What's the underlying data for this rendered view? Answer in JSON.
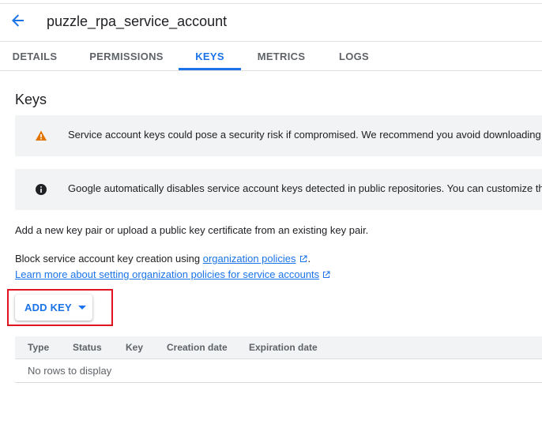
{
  "header": {
    "title": "puzzle_rpa_service_account",
    "back_icon": "arrow-back-icon"
  },
  "tabs": [
    {
      "label": "DETAILS",
      "active": false
    },
    {
      "label": "PERMISSIONS",
      "active": false
    },
    {
      "label": "KEYS",
      "active": true
    },
    {
      "label": "METRICS",
      "active": false
    },
    {
      "label": "LOGS",
      "active": false
    }
  ],
  "section": {
    "title": "Keys"
  },
  "banners": {
    "warning": {
      "icon": "warning-icon",
      "color": "#e37400",
      "text": "Service account keys could pose a security risk if compromised. We recommend you avoid downloading service account keys and instead use the Workload Identity Federation."
    },
    "info": {
      "icon": "info-icon",
      "color": "#202124",
      "text": "Google automatically disables service account keys detected in public repositories. You can customize this behavior by using the organization policy."
    }
  },
  "body": {
    "add_key_hint": "Add a new key pair or upload a public key certificate from an existing key pair.",
    "block_text": "Block service account key creation using ",
    "org_policies_link": "organization policies",
    "block_text_end": ".",
    "learn_more_link": "Learn more about setting organization policies for service accounts"
  },
  "add_key_button": {
    "label": "ADD KEY"
  },
  "table": {
    "columns": [
      "Type",
      "Status",
      "Key",
      "Creation date",
      "Expiration date"
    ],
    "empty_message": "No rows to display"
  },
  "colors": {
    "accent": "#1a73e8",
    "highlight": "#e0141e",
    "banner_bg": "#f1f3f4"
  }
}
